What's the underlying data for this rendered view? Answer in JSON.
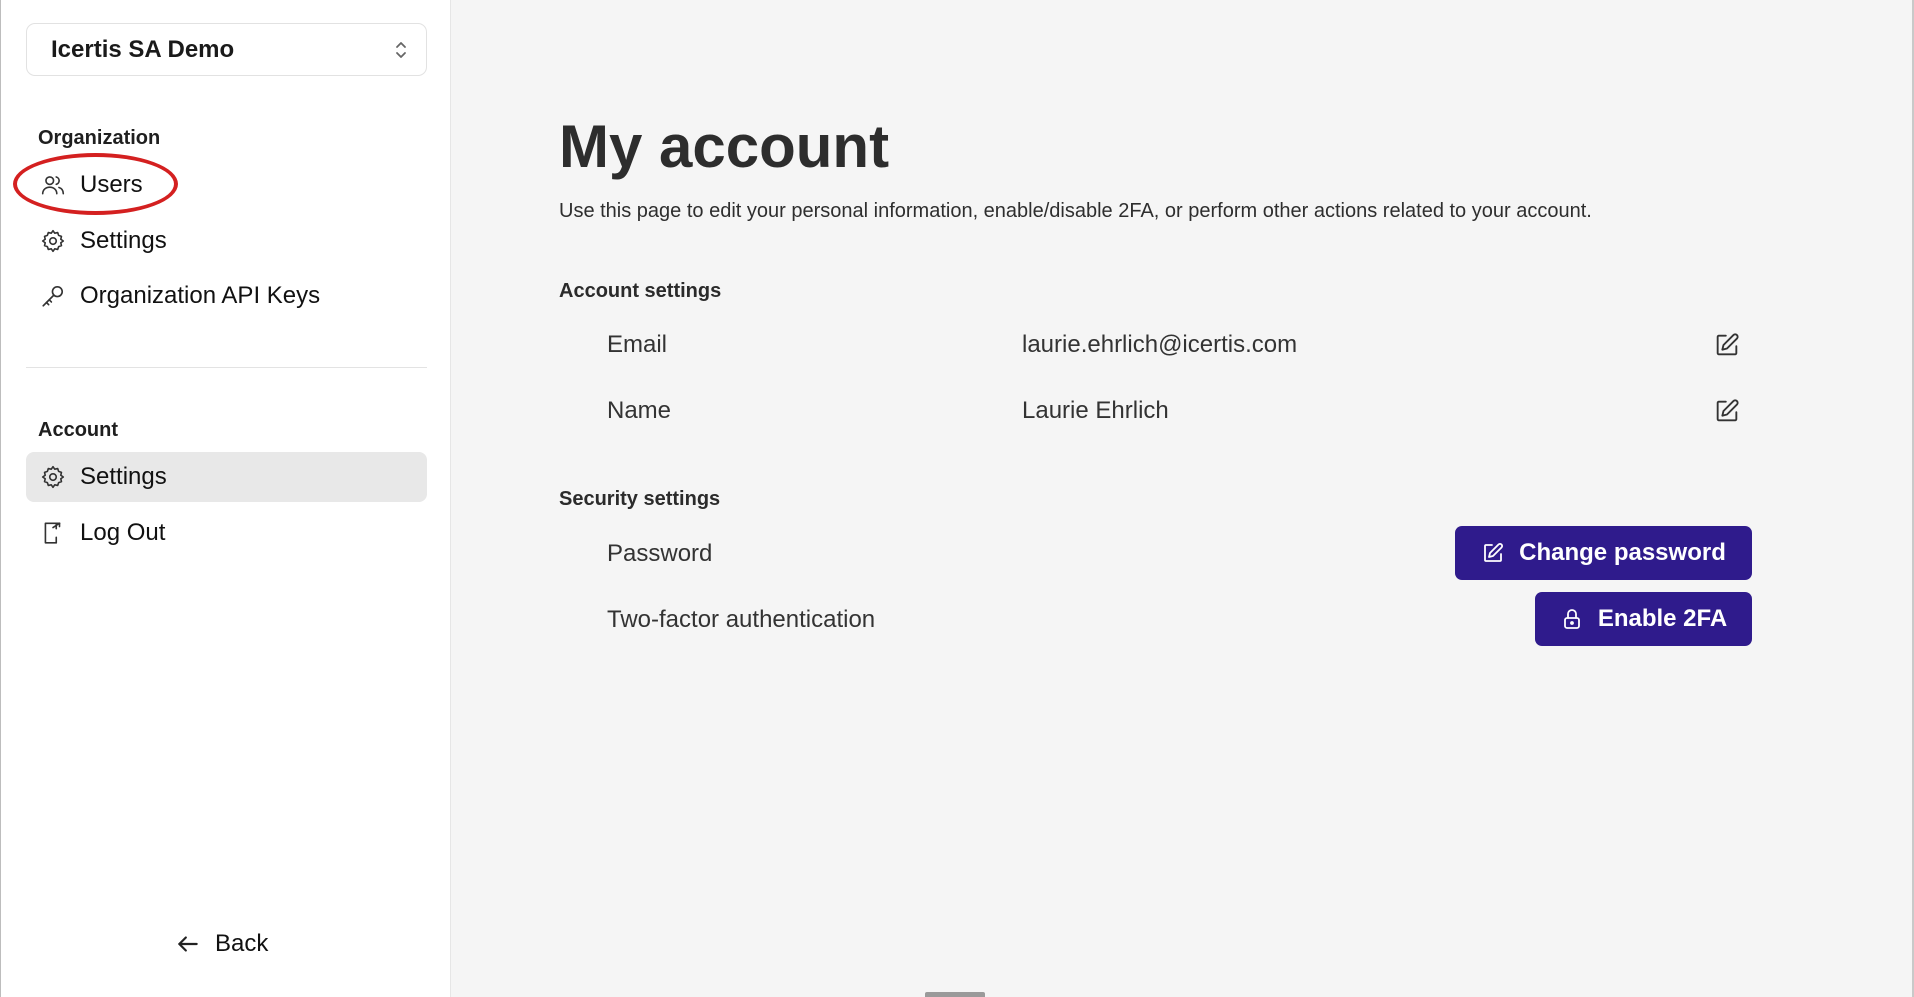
{
  "sidebar": {
    "org_selector": {
      "value": "Icertis SA Demo",
      "icon": "chevron-up-down-icon"
    },
    "organization": {
      "label": "Organization",
      "items": [
        {
          "label": "Users",
          "icon": "users-icon"
        },
        {
          "label": "Settings",
          "icon": "gear-icon"
        },
        {
          "label": "Organization API Keys",
          "icon": "key-icon"
        }
      ]
    },
    "account": {
      "label": "Account",
      "items": [
        {
          "label": "Settings",
          "icon": "gear-icon",
          "active": true
        },
        {
          "label": "Log Out",
          "icon": "logout-icon"
        }
      ]
    },
    "back": {
      "label": "Back",
      "icon": "arrow-left-icon"
    }
  },
  "main": {
    "title": "My account",
    "description": "Use this page to edit your personal information, enable/disable 2FA, or perform other actions related to your account.",
    "account_settings": {
      "label": "Account settings",
      "rows": [
        {
          "label": "Email",
          "value": "laurie.ehrlich@icertis.com"
        },
        {
          "label": "Name",
          "value": "Laurie Ehrlich"
        }
      ]
    },
    "security_settings": {
      "label": "Security settings",
      "rows": [
        {
          "label": "Password",
          "button": "Change password",
          "icon": "edit-icon"
        },
        {
          "label": "Two-factor authentication",
          "button": "Enable 2FA",
          "icon": "lock-icon"
        }
      ]
    }
  },
  "colors": {
    "primary_button": "#2f1b8c",
    "active_nav": "#e8e8e8",
    "annotation": "#d42020"
  }
}
